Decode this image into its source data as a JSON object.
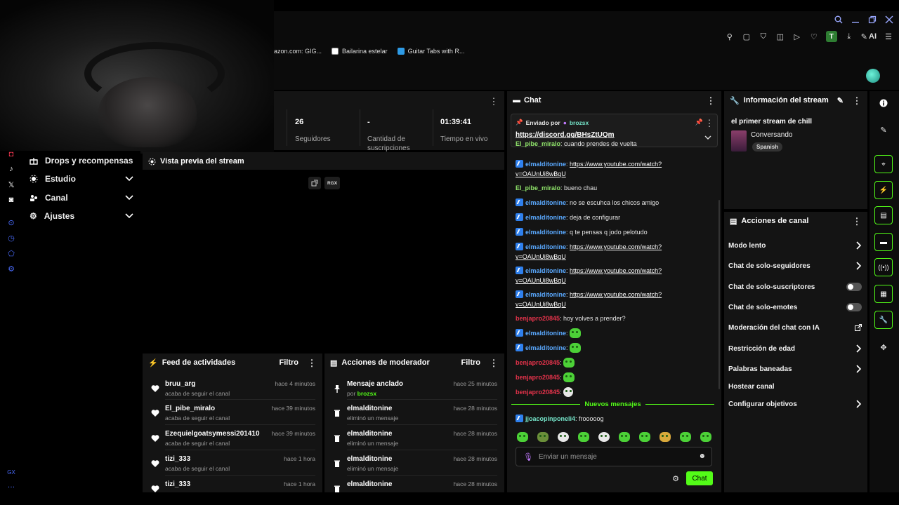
{
  "browser": {
    "bookmarks": [
      {
        "label": "azon.com: GIG..."
      },
      {
        "label": "Bailarina estelar"
      },
      {
        "label": "Guitar Tabs with R..."
      }
    ],
    "ai_label": "AI",
    "profile_initial": "T"
  },
  "nav": {
    "items": [
      {
        "label": "Drops y recompensas"
      },
      {
        "label": "Estudio"
      },
      {
        "label": "Canal"
      },
      {
        "label": "Ajustes"
      }
    ]
  },
  "rail": {
    "bottom_label": "GX"
  },
  "stats": {
    "followers_value": "26",
    "followers_label": "Seguidores",
    "subs_value": "-",
    "subs_label": "Cantidad de suscripciones",
    "live_value": "01:39:41",
    "live_label": "Tiempo en vivo"
  },
  "preview": {
    "title": "Vista previa del stream",
    "rgx_label": "RGX"
  },
  "activity_feed": {
    "title": "Feed de actividades",
    "filter_label": "Filtro",
    "items": [
      {
        "name": "bruu_arg",
        "sub": "acaba de seguir el canal",
        "time": "hace 4 minutos"
      },
      {
        "name": "El_pibe_miralo",
        "sub": "acaba de seguir el canal",
        "time": "hace 39 minutos"
      },
      {
        "name": "Ezequielgoatsymessi201410",
        "sub": "acaba de seguir el canal",
        "time": "hace 39 minutos"
      },
      {
        "name": "tizi_333",
        "sub": "acaba de seguir el canal",
        "time": "hace 1 hora"
      },
      {
        "name": "tizi_333",
        "sub": "",
        "time": "hace 1 hora"
      }
    ]
  },
  "mod_actions": {
    "title": "Acciones de moderador",
    "filter_label": "Filtro",
    "items": [
      {
        "name": "Mensaje anclado",
        "sub_prefix": "por ",
        "sub_user": "brozsx",
        "time": "hace 25 minutos"
      },
      {
        "name": "elmalditonine",
        "sub": "eliminó un mensaje",
        "time": "hace 28 minutos"
      },
      {
        "name": "elmalditonine",
        "sub": "eliminó un mensaje",
        "time": "hace 28 minutos"
      },
      {
        "name": "elmalditonine",
        "sub": "eliminó un mensaje",
        "time": "hace 28 minutos"
      },
      {
        "name": "elmalditonine",
        "sub": "",
        "time": "hace 28 minutos"
      }
    ]
  },
  "chat": {
    "title": "Chat",
    "pinned": {
      "sent_by": "Enviado por",
      "user": "brozsx",
      "link": "https://discord.gg/BHsZtUQm"
    },
    "messages": [
      {
        "user": "El_pibe_miralo",
        "color": "green",
        "badge": false,
        "text": ": cuando prendes de vuelta"
      },
      {
        "user": "elmalditonine",
        "color": "blue",
        "badge": true,
        "link": "https://www.youtube.com/watch?v=OAUnUi8wBqU"
      },
      {
        "user": "El_pibe_miralo",
        "color": "green",
        "badge": false,
        "text": ": bueno chau"
      },
      {
        "user": "elmalditonine",
        "color": "blue",
        "badge": true,
        "text": ": no se escuhca los chicos amigo"
      },
      {
        "user": "elmalditonine",
        "color": "blue",
        "badge": true,
        "text": ": deja de configurar"
      },
      {
        "user": "elmalditonine",
        "color": "blue",
        "badge": true,
        "text": ": q te pensas q jodo pelotudo"
      },
      {
        "user": "elmalditonine",
        "color": "blue",
        "badge": true,
        "link": "https://www.youtube.com/watch?v=OAUnUi8wBqU"
      },
      {
        "user": "elmalditonine",
        "color": "blue",
        "badge": true,
        "link": "https://www.youtube.com/watch?v=OAUnUi8wBqU"
      },
      {
        "user": "elmalditonine",
        "color": "blue",
        "badge": true,
        "link": "https://www.youtube.com/watch?v=OAUnUi8wBqU"
      },
      {
        "user": "benjapro20845",
        "color": "red",
        "badge": false,
        "text": ": hoy volves a prender?"
      },
      {
        "user": "elmalditonine",
        "color": "blue",
        "badge": true,
        "emote": true
      },
      {
        "user": "elmalditonine",
        "color": "blue",
        "badge": true,
        "emote": true
      },
      {
        "user": "benjapro20845",
        "color": "red",
        "badge": false,
        "emote": true
      },
      {
        "user": "benjapro20845",
        "color": "red",
        "badge": false,
        "emote": true
      },
      {
        "user": "benjapro20845",
        "color": "red",
        "badge": false,
        "emote": true,
        "face": true
      }
    ],
    "new_messages_label": "Nuevos mensajes",
    "after_new": {
      "user": "jjoacopinponeli4",
      "text": ": frooooog"
    },
    "input_placeholder": "Enviar un mensaje",
    "send_label": "Chat"
  },
  "stream_info": {
    "title": "Información del stream",
    "stream_title": "el primer stream de chill",
    "category": "Conversando",
    "language": "Spanish"
  },
  "channel_actions": {
    "title": "Acciones de canal",
    "items": [
      {
        "label": "Modo lento",
        "control": "chevron"
      },
      {
        "label": "Chat de solo-seguidores",
        "control": "chevron"
      },
      {
        "label": "Chat de solo-suscriptores",
        "control": "toggle"
      },
      {
        "label": "Chat de solo-emotes",
        "control": "toggle"
      },
      {
        "label": "Moderación del chat con IA",
        "control": "external"
      },
      {
        "label": "Restricción de edad",
        "control": "chevron"
      },
      {
        "label": "Palabras baneadas",
        "control": "chevron"
      },
      {
        "label": "Hostear canal",
        "control": "none"
      },
      {
        "label": "Configurar objetivos",
        "control": "chevron"
      }
    ]
  },
  "colors": {
    "accent": "#53fc18",
    "panel": "#141414",
    "user_blue": "#5aa9ff",
    "user_red": "#e5334b"
  }
}
